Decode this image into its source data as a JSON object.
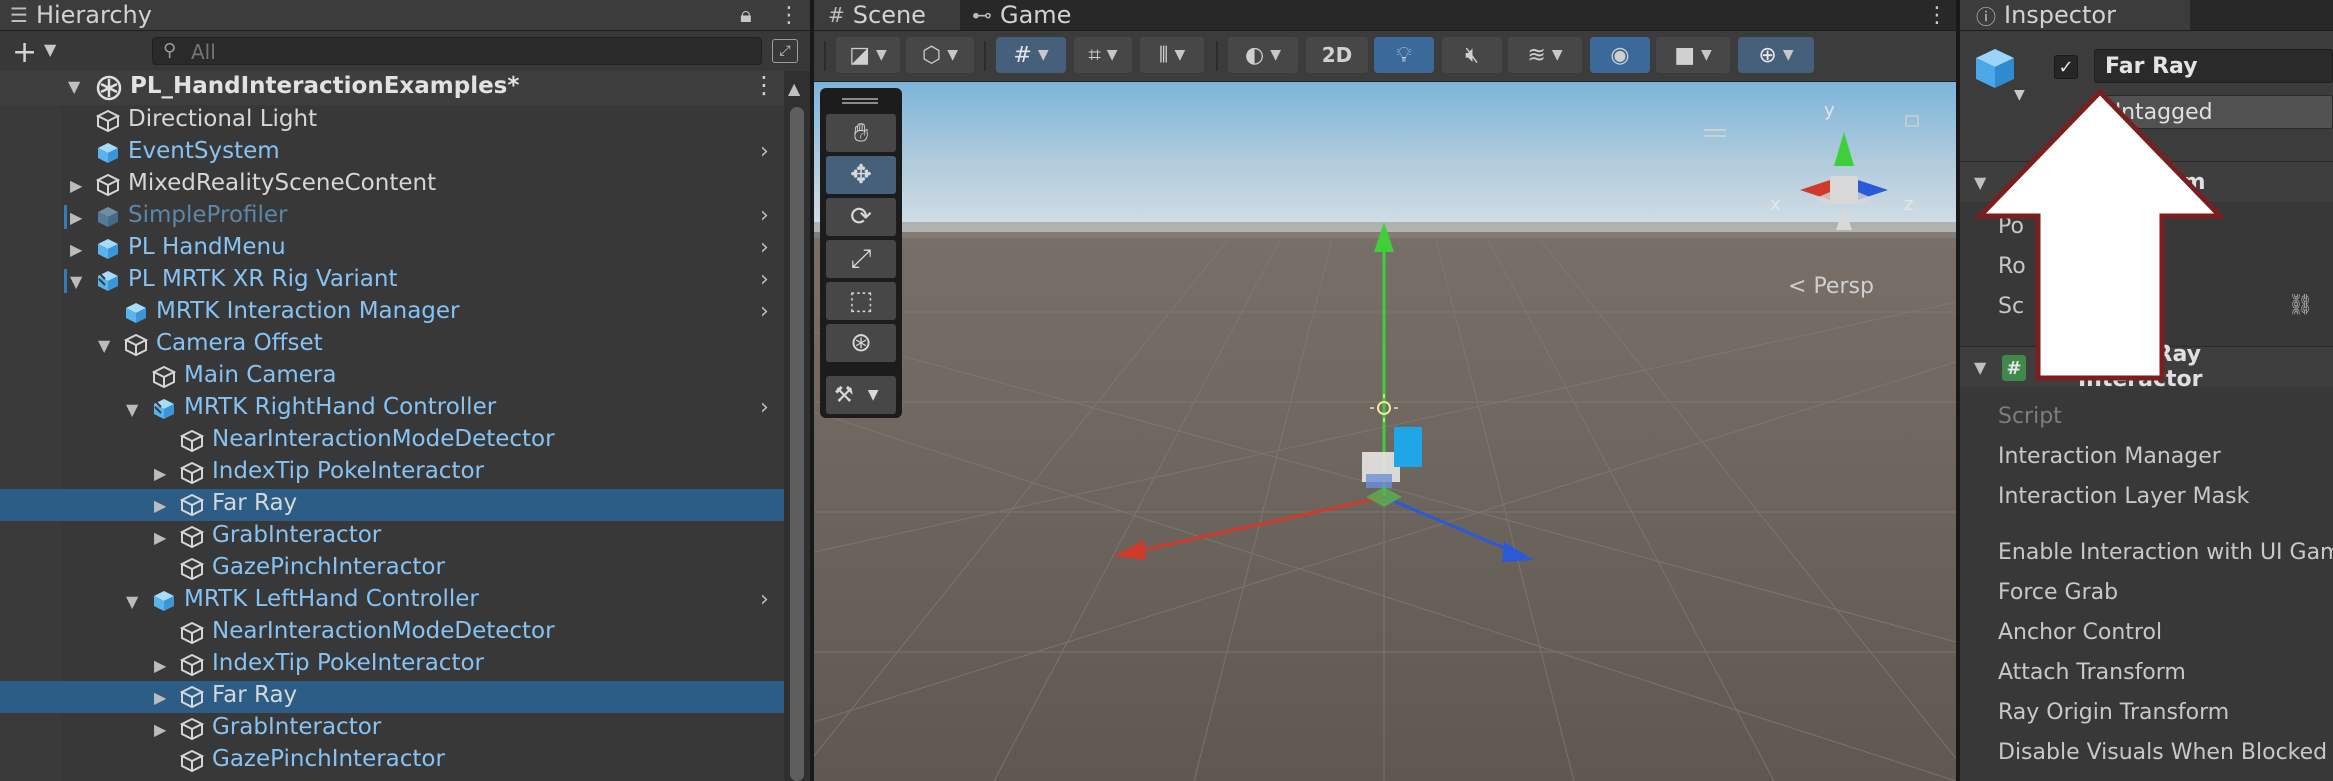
{
  "hierarchy": {
    "tab_title": "Hierarchy",
    "search_placeholder": "All",
    "scene_name": "PL_HandInteractionExamples*",
    "rows": [
      {
        "label": "Directional Light",
        "indent": 0,
        "icon": "gameobject-icon",
        "style": "normal",
        "tri": "",
        "chev": false,
        "sel": false
      },
      {
        "label": "EventSystem",
        "indent": 0,
        "icon": "prefab-icon",
        "style": "blue",
        "tri": "",
        "chev": true,
        "sel": false
      },
      {
        "label": "MixedRealitySceneContent",
        "indent": 0,
        "icon": "gameobject-icon",
        "style": "normal",
        "tri": "right",
        "chev": false,
        "sel": false
      },
      {
        "label": "SimpleProfiler",
        "indent": 0,
        "icon": "prefab-dim-icon",
        "style": "dim",
        "tri": "right",
        "chev": true,
        "sel": false
      },
      {
        "label": "PL HandMenu",
        "indent": 0,
        "icon": "prefab-icon",
        "style": "blue",
        "tri": "right",
        "chev": true,
        "sel": false
      },
      {
        "label": "PL MRTK XR Rig Variant",
        "indent": 0,
        "icon": "prefab-variant-icon",
        "style": "blue",
        "tri": "down",
        "chev": true,
        "sel": false
      },
      {
        "label": "MRTK Interaction Manager",
        "indent": 1,
        "icon": "prefab-icon",
        "style": "blue",
        "tri": "",
        "chev": true,
        "sel": false
      },
      {
        "label": "Camera Offset",
        "indent": 1,
        "icon": "gameobject-icon",
        "style": "blue",
        "tri": "down",
        "chev": false,
        "sel": false
      },
      {
        "label": "Main Camera",
        "indent": 2,
        "icon": "gameobject-icon",
        "style": "blue",
        "tri": "",
        "chev": false,
        "sel": false
      },
      {
        "label": "MRTK RightHand Controller",
        "indent": 2,
        "icon": "prefab-variant-icon",
        "style": "blue",
        "tri": "down",
        "chev": true,
        "sel": false
      },
      {
        "label": "NearInteractionModeDetector",
        "indent": 3,
        "icon": "gameobject-icon",
        "style": "blue",
        "tri": "",
        "chev": false,
        "sel": false
      },
      {
        "label": "IndexTip PokeInteractor",
        "indent": 3,
        "icon": "gameobject-icon",
        "style": "blue",
        "tri": "right",
        "chev": false,
        "sel": false
      },
      {
        "label": "Far Ray",
        "indent": 3,
        "icon": "gameobject-icon",
        "style": "normal",
        "tri": "right",
        "chev": false,
        "sel": true
      },
      {
        "label": "GrabInteractor",
        "indent": 3,
        "icon": "gameobject-icon",
        "style": "blue",
        "tri": "right",
        "chev": false,
        "sel": false
      },
      {
        "label": "GazePinchInteractor",
        "indent": 3,
        "icon": "gameobject-icon",
        "style": "blue",
        "tri": "",
        "chev": false,
        "sel": false
      },
      {
        "label": "MRTK LeftHand Controller",
        "indent": 2,
        "icon": "prefab-icon",
        "style": "blue",
        "tri": "down",
        "chev": true,
        "sel": false
      },
      {
        "label": "NearInteractionModeDetector",
        "indent": 3,
        "icon": "gameobject-icon",
        "style": "blue",
        "tri": "",
        "chev": false,
        "sel": false
      },
      {
        "label": "IndexTip PokeInteractor",
        "indent": 3,
        "icon": "gameobject-icon",
        "style": "blue",
        "tri": "right",
        "chev": false,
        "sel": false
      },
      {
        "label": "Far Ray",
        "indent": 3,
        "icon": "gameobject-icon",
        "style": "normal",
        "tri": "right",
        "chev": false,
        "sel": true
      },
      {
        "label": "GrabInteractor",
        "indent": 3,
        "icon": "gameobject-icon",
        "style": "blue",
        "tri": "right",
        "chev": false,
        "sel": false
      },
      {
        "label": "GazePinchInteractor",
        "indent": 3,
        "icon": "gameobject-icon",
        "style": "blue",
        "tri": "",
        "chev": false,
        "sel": false
      }
    ]
  },
  "scene_view": {
    "tabs": [
      {
        "label": "Scene"
      },
      {
        "label": "Game"
      }
    ],
    "toolbar": {
      "two_d_label": "2D"
    },
    "persp_label": "Persp",
    "gizmo_axes": {
      "x": "x",
      "y": "y",
      "z": "z"
    }
  },
  "inspector": {
    "tab_title": "Inspector",
    "object_name": "Far Ray",
    "tag_value": "Untagged",
    "transform_header": "Transform",
    "transform_props": [
      "Po",
      "Ro",
      "Sc"
    ],
    "component_header": "MRTK Ray Interactor",
    "props": [
      "Script",
      "Interaction Manager",
      "Interaction Layer Mask",
      "Enable Interaction with UI GameObjects",
      "Force Grab",
      "Anchor Control",
      "Attach Transform",
      "Ray Origin Transform",
      "Disable Visuals When Blocked"
    ]
  },
  "colors": {
    "selection": "#2c5d87",
    "prefab_blue": "#86c3f5",
    "arrow_outline": "#7a1e1e",
    "axis_x": "#d03a2a",
    "axis_y": "#3fcf3a",
    "axis_z": "#2a5ad8"
  }
}
